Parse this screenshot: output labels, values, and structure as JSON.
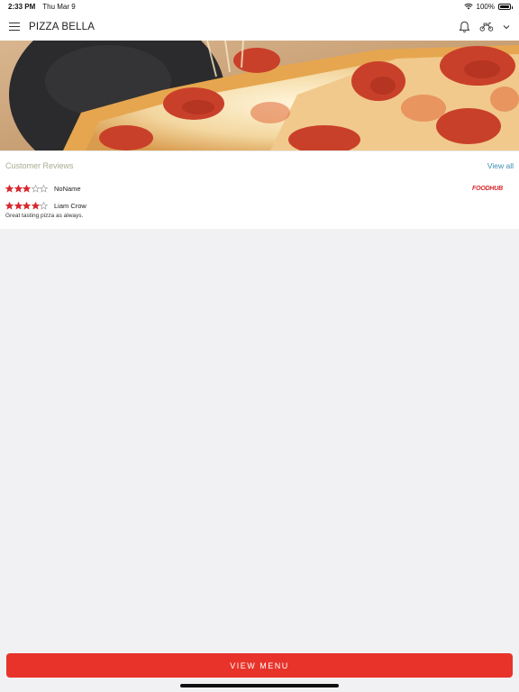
{
  "status_bar": {
    "time": "2:33 PM",
    "date": "Thu Mar 9",
    "battery": "100%",
    "battery_level": 1.0
  },
  "header": {
    "title": "PIZZA BELLA",
    "icons": [
      "menu-icon",
      "bell-icon",
      "scooter-icon",
      "chevron-down-icon"
    ]
  },
  "reviews": {
    "title": "Customer Reviews",
    "view_all": "View all",
    "source": "FOODHUB",
    "items": [
      {
        "name": "NoName",
        "rating": 3,
        "max_rating": 5,
        "text": ""
      },
      {
        "name": "Liam Crow",
        "rating": 4,
        "max_rating": 5,
        "text": "Great tasting pizza as always."
      }
    ]
  },
  "colors": {
    "accent": "#e8332a",
    "star": "#d8282f",
    "link": "#3d8fb0",
    "section_title": "#a7ad8e"
  },
  "footer": {
    "button_label": "VIEW MENU"
  }
}
